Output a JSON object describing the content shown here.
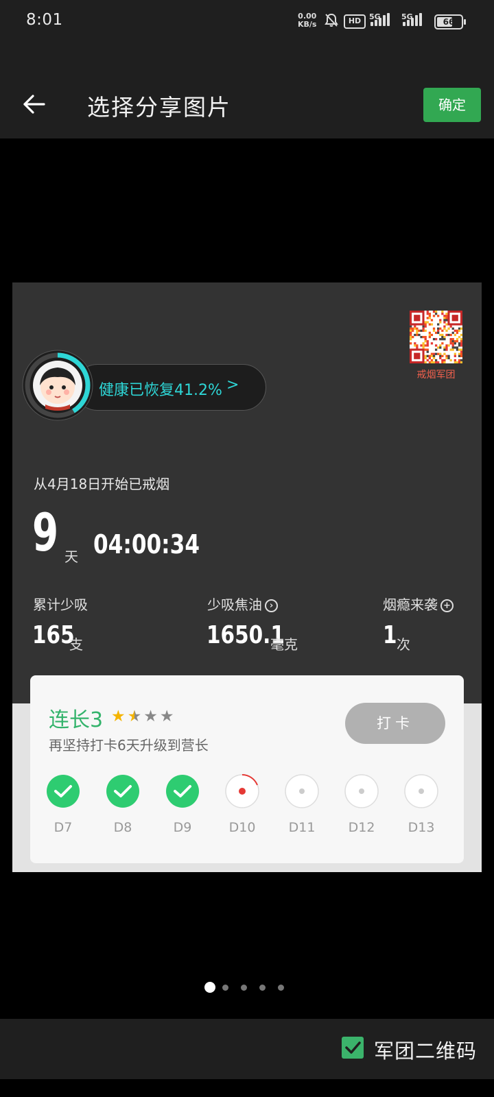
{
  "status": {
    "time": "8:01",
    "net_speed_value": "0.00",
    "net_speed_unit": "KB/s",
    "hd_badge": "HD",
    "sim1_label": "5G",
    "sim2_label": "5G",
    "battery": "66",
    "battery_level": 0.66
  },
  "appbar": {
    "title": "选择分享图片",
    "confirm_label": "确定"
  },
  "card": {
    "qr_caption": "戒烟军团",
    "health_text": "健康已恢复41.2%",
    "health_arrow": ">",
    "health_progress": 0.412,
    "quit_since": "从4月18日开始已戒烟",
    "days": "9",
    "days_unit": "天",
    "timer": "04:00:34",
    "stats": [
      {
        "label": "累计少吸",
        "value": "165",
        "unit": "支",
        "icon": ""
      },
      {
        "label": "少吸焦油",
        "value": "1650.1",
        "unit": "毫克",
        "icon": "arrow-right-circle-icon"
      },
      {
        "label": "烟瘾来袭",
        "value": "1",
        "unit": "次",
        "icon": "plus-circle-icon"
      }
    ],
    "rank": {
      "title": "连长3",
      "stars_total": 4,
      "stars_value": 1.5,
      "subtitle": "再坚持打卡6天升级到营长",
      "checkin_label": "打卡",
      "days": [
        {
          "label": "D7",
          "state": "done"
        },
        {
          "label": "D8",
          "state": "done"
        },
        {
          "label": "D9",
          "state": "done"
        },
        {
          "label": "D10",
          "state": "current"
        },
        {
          "label": "D11",
          "state": "pending"
        },
        {
          "label": "D12",
          "state": "pending"
        },
        {
          "label": "D13",
          "state": "pending"
        }
      ]
    }
  },
  "pager": {
    "count": 5,
    "active": 0
  },
  "bottom": {
    "qr_checkbox_checked": true,
    "qr_checkbox_label": "军团二维码"
  },
  "colors": {
    "accent_green": "#33b36b",
    "confirm_green": "#32a852",
    "cyan": "#2ed6d6",
    "star_gold": "#f4b400",
    "qr_caption_red": "#f0604d"
  }
}
